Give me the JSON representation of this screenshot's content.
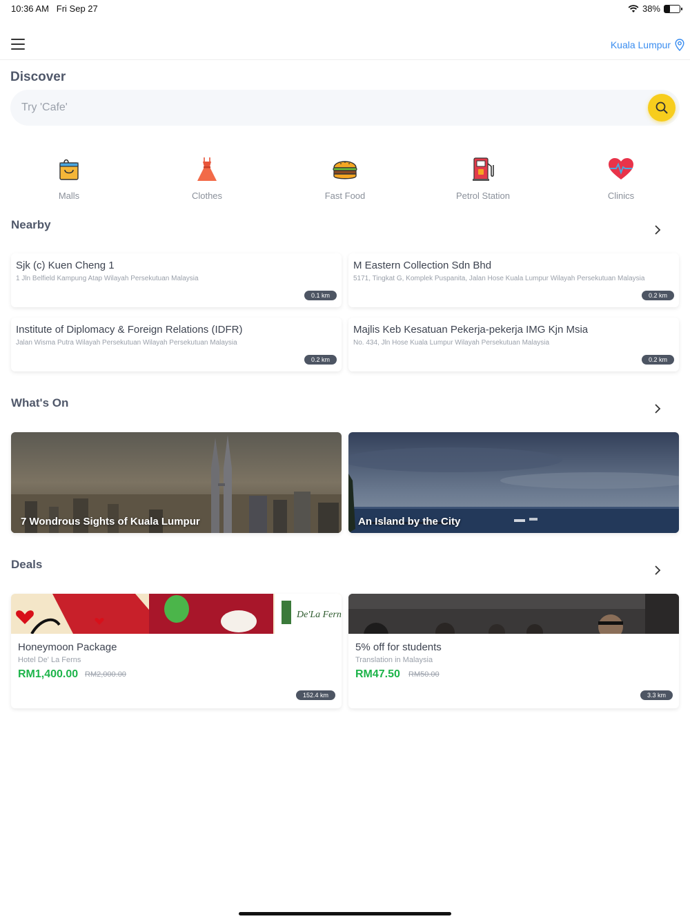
{
  "status_bar": {
    "time": "10:36 AM",
    "date": "Fri Sep 27",
    "battery": "38%",
    "battery_level": 0.38
  },
  "header": {
    "location": "Kuala Lumpur"
  },
  "discover": {
    "title": "Discover",
    "search_placeholder": "Try 'Cafe'"
  },
  "categories": [
    {
      "label": "Malls",
      "icon": "shopping-bag-icon"
    },
    {
      "label": "Clothes",
      "icon": "dress-icon"
    },
    {
      "label": "Fast Food",
      "icon": "burger-icon"
    },
    {
      "label": "Petrol Station",
      "icon": "fuel-pump-icon"
    },
    {
      "label": "Clinics",
      "icon": "heart-pulse-icon"
    }
  ],
  "nearby": {
    "title": "Nearby",
    "items": [
      {
        "name": "Sjk (c) Kuen Cheng 1",
        "address": "1 Jln Belfield Kampung Atap Wilayah Persekutuan Malaysia",
        "distance": "0.1 km"
      },
      {
        "name": "M Eastern Collection Sdn Bhd",
        "address": "5171, Tingkat G, Komplek Puspanita, Jalan Hose Kuala Lumpur Wilayah Persekutuan Malaysia",
        "distance": "0.2 km"
      },
      {
        "name": "Institute of Diplomacy & Foreign Relations (IDFR)",
        "address": "Jalan Wisma Putra Wilayah Persekutuan Wilayah Persekutuan Malaysia",
        "distance": "0.2 km"
      },
      {
        "name": "Majlis Keb Kesatuan Pekerja-pekerja IMG Kjn Msia",
        "address": "No. 434, Jln Hose Kuala Lumpur Wilayah Persekutuan Malaysia",
        "distance": "0.2 km"
      }
    ]
  },
  "whats_on": {
    "title": "What's On",
    "items": [
      {
        "title": "7 Wondrous Sights of Kuala Lumpur"
      },
      {
        "title": "An Island by the City"
      }
    ]
  },
  "deals": {
    "title": "Deals",
    "items": [
      {
        "name": "Honeymoon Package",
        "merchant": "Hotel De' La Ferns",
        "price": "RM1,400.00",
        "old_price": "RM2,000.00",
        "distance": "152.4 km",
        "logo_text": "De'La Ferns"
      },
      {
        "name": "5% off for students",
        "merchant": "Translation in Malaysia",
        "price": "RM47.50",
        "old_price": "RM50.00",
        "distance": "3.3 km"
      }
    ]
  }
}
